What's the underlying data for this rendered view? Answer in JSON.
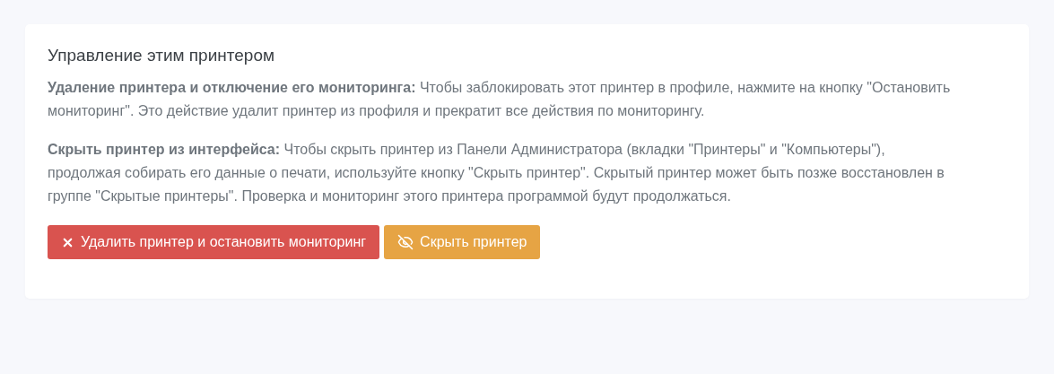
{
  "card": {
    "title": "Управление этим принтером",
    "paragraphs": [
      "**Удаление принтера и отключение его мониторинга:** Чтобы заблокировать этот принтер в профиле, нажмите на кнопку \"Остановить мониторинг\". Это действие удалит принтер из профиля и прекратит все действия по мониторингу.",
      "**Скрыть принтер из интерфейса:** Чтобы скрыть принтер из Панели Администратора (вкладки \"Принтеры\" и \"Компьютеры\"), продолжая собирать его данные о печати, используйте кнопку \"Скрыть принтер\". Скрытый принтер может быть позже восстановлен в группе \"Скрытые принтеры\". Проверка и мониторинг этого принтера программой будут продолжаться."
    ],
    "buttons": [
      {
        "kind": "danger",
        "label": "Удалить принтер и остановить мониторинг"
      },
      {
        "kind": "warning",
        "label": "Скрыть принтер"
      }
    ]
  }
}
